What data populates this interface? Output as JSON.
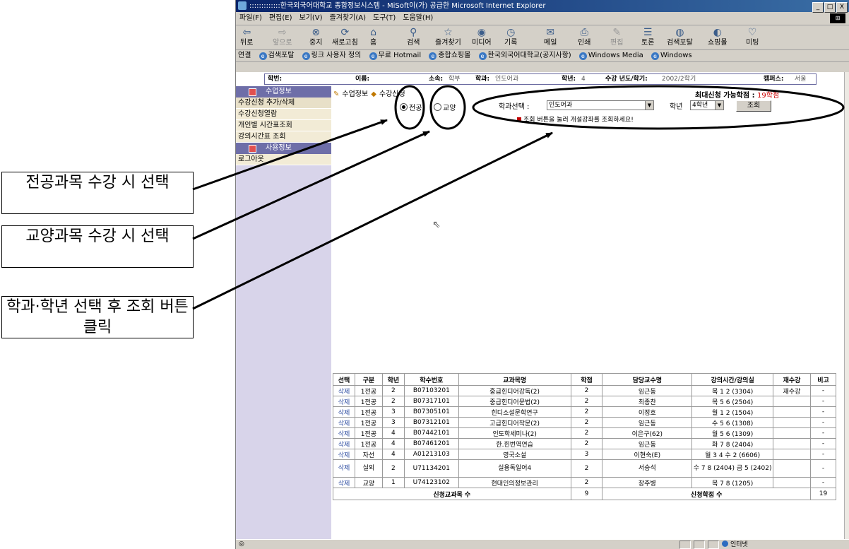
{
  "callouts": {
    "major": "전공과목 수강 시 선택",
    "general": "교양과목 수강 시 선택",
    "query": "학과·학년 선택 후 조회 버튼 클릭"
  },
  "window": {
    "title": ":::::::::::::한국외국어대학교 종합정보시스템 - MiSoft이(가) 공급한 Microsoft Internet Explorer",
    "controls": [
      "_",
      "□",
      "X"
    ]
  },
  "menubar": [
    "파일(F)",
    "편집(E)",
    "보기(V)",
    "즐겨찾기(A)",
    "도구(T)",
    "도움말(H)"
  ],
  "toolbar": [
    {
      "label": "뒤로",
      "icon": "back-arrow-icon",
      "glyph": "⇦"
    },
    {
      "label": "앞으로",
      "icon": "forward-arrow-icon",
      "glyph": "⇨"
    },
    {
      "label": "중지",
      "icon": "stop-icon",
      "glyph": "⊗"
    },
    {
      "label": "새로고침",
      "icon": "refresh-icon",
      "glyph": "⟳"
    },
    {
      "label": "홈",
      "icon": "home-icon",
      "glyph": "⌂"
    },
    {
      "label": "검색",
      "icon": "search-icon",
      "glyph": "⚲"
    },
    {
      "label": "즐겨찾기",
      "icon": "favorites-icon",
      "glyph": "☆"
    },
    {
      "label": "미디어",
      "icon": "media-icon",
      "glyph": "◉"
    },
    {
      "label": "기록",
      "icon": "history-icon",
      "glyph": "◷"
    },
    {
      "label": "메일",
      "icon": "mail-icon",
      "glyph": "✉"
    },
    {
      "label": "인쇄",
      "icon": "print-icon",
      "glyph": "⎙"
    },
    {
      "label": "편집",
      "icon": "edit-icon",
      "glyph": "✎"
    },
    {
      "label": "토론",
      "icon": "discuss-icon",
      "glyph": "☰"
    },
    {
      "label": "검색포탈",
      "icon": "portal-icon",
      "glyph": "◍"
    },
    {
      "label": "쇼핑몰",
      "icon": "shopping-icon",
      "glyph": "◐"
    },
    {
      "label": "미팅",
      "icon": "meeting-icon",
      "glyph": "♡"
    }
  ],
  "linksbar": {
    "label": "연결",
    "links": [
      "검색포탈",
      "링크 사용자 정의",
      "무료 Hotmail",
      "종합쇼핑몰",
      "한국외국어대학교(공지사항)",
      "Windows Media",
      "Windows"
    ]
  },
  "student_info": {
    "id_label": "학번:",
    "id_value": "",
    "name_label": "이름:",
    "name_value": "",
    "affil_label": "소속:",
    "affil_value": "학부",
    "dept_label": "학과:",
    "dept_value": "인도어과",
    "grade_label": "학년:",
    "grade_value": "4",
    "term_label": "수강 년도/학기:",
    "term_value": "2002/2학기",
    "campus_label": "캠퍼스:",
    "campus_value": "서울"
  },
  "nav": {
    "section1": "수업정보",
    "items": [
      "수강신청 추가/삭제",
      "수강신청열람",
      "개인별 시간표조회",
      "강의시간표 조회"
    ],
    "section2": "사용정보",
    "logout": "로그아웃"
  },
  "breadcrumb": {
    "part1": "수업정보",
    "part2": "수강신청"
  },
  "course_type": {
    "major": "전공",
    "general": "교양",
    "selected": "major"
  },
  "limits": {
    "label": "최대신청 가능학점 :",
    "value": "19학점"
  },
  "filter": {
    "dept_label": "학과선택 :",
    "dept_value": "인도어과",
    "grade_label": "학년",
    "grade_value": "4학년",
    "query_button": "조회",
    "hint": "조회 버튼을 눌러 개설강좌를 조회하세요!"
  },
  "table": {
    "headers": [
      "선택",
      "구분",
      "학년",
      "학수번호",
      "교과목명",
      "학점",
      "담당교수명",
      "강의시간/강의실",
      "재수강",
      "비고"
    ],
    "rows": [
      [
        "삭제",
        "1전공",
        "2",
        "B07103201",
        "중급힌디어강독(2)",
        "2",
        "임근동",
        "목 1 2 (3304)",
        "재수강",
        "-"
      ],
      [
        "삭제",
        "1전공",
        "2",
        "B07317101",
        "중급힌디어문법(2)",
        "2",
        "최종찬",
        "목 5 6 (2504)",
        "",
        "-"
      ],
      [
        "삭제",
        "1전공",
        "3",
        "B07305101",
        "힌디소설문학연구",
        "2",
        "이정호",
        "월 1 2 (1504)",
        "",
        "-"
      ],
      [
        "삭제",
        "1전공",
        "3",
        "B07312101",
        "고급힌디어작문(2)",
        "2",
        "임근동",
        "수 5 6 (1308)",
        "",
        "-"
      ],
      [
        "삭제",
        "1전공",
        "4",
        "B07442101",
        "인도학세미나(2)",
        "2",
        "이은구(62)",
        "월 5 6 (1309)",
        "",
        "-"
      ],
      [
        "삭제",
        "1전공",
        "4",
        "B07461201",
        "한.힌번역연습",
        "2",
        "임근동",
        "화 7 8 (2404)",
        "",
        "-"
      ],
      [
        "삭제",
        "자선",
        "4",
        "A01213103",
        "영국소설",
        "3",
        "이현숙(E)",
        "월 3 4 수 2 (6606)",
        "",
        "-"
      ],
      [
        "삭제",
        "실외",
        "2",
        "U71134201",
        "실용독일어4",
        "2",
        "서승석",
        "수 7 8 (2404) 금 5 (2402)",
        "",
        "-"
      ],
      [
        "삭제",
        "교양",
        "1",
        "U74123102",
        "현대인의정보관리",
        "2",
        "장주병",
        "목 7 8 (1205)",
        "",
        "-"
      ]
    ],
    "summary": {
      "courses_label": "신청교과목 수",
      "courses_value": "9",
      "credits_label": "신청학점 수",
      "credits_value": "19"
    }
  },
  "statusbar": {
    "zone": "인터넷"
  },
  "colors": {
    "accent": "#6e6ea8",
    "title_start": "#0a246a",
    "warning": "#cc0000"
  }
}
